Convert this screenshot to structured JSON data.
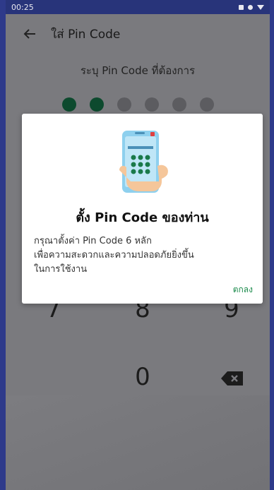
{
  "status_bar": {
    "time": "00:25"
  },
  "app_bar": {
    "title": "ใส่ Pin Code"
  },
  "pin_entry": {
    "hint": "ระบุ Pin Code ที่ต้องการ",
    "total_digits": 6,
    "entered_digits": 2
  },
  "keypad": {
    "keys": [
      "7",
      "8",
      "9",
      "0"
    ]
  },
  "dialog": {
    "title": "ตั้ง Pin Code ของท่าน",
    "body_lines": [
      "กรุณาตั้งค่า Pin Code 6 หลัก",
      "เพื่อความสะดวกและความปลอดภัยยิ่งขึ้น",
      "ในการใช้งาน"
    ],
    "ok_label": "ตกลง"
  },
  "colors": {
    "accent": "#1a8a4a",
    "filled_dot": "#0d4a2e",
    "status_bar": "#28347a"
  }
}
